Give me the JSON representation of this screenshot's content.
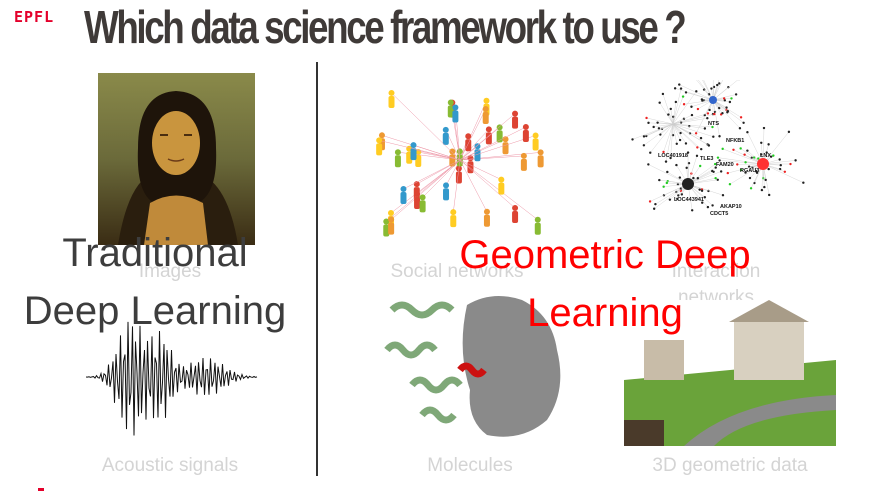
{
  "header": {
    "logo": "EPFL",
    "title": "Which data science framework to use ?"
  },
  "left": {
    "heading_line1": "Traditional",
    "heading_line2": "Deep Learning",
    "captions": {
      "images": "Images",
      "acoustic": "Acoustic signals"
    }
  },
  "right": {
    "heading_line1": "Geometric Deep",
    "heading_line2": "Learning",
    "captions": {
      "social": "Social networks",
      "interaction_line1": "Interaction",
      "interaction_line2": "networks",
      "molecules": "Molecules",
      "geometric3d": "3D geometric data"
    }
  },
  "network_labels": [
    "NTS",
    "LOC401918",
    "TLE3",
    "FAM20",
    "LNX",
    "NFKB1",
    "RGAU3",
    "LOC443941",
    "AKAP10",
    "CDCT5"
  ],
  "colors": {
    "title": "#3f3a38",
    "accent": "#ff0000",
    "caption": "#d4d4d4",
    "logo": "#e4002b"
  }
}
